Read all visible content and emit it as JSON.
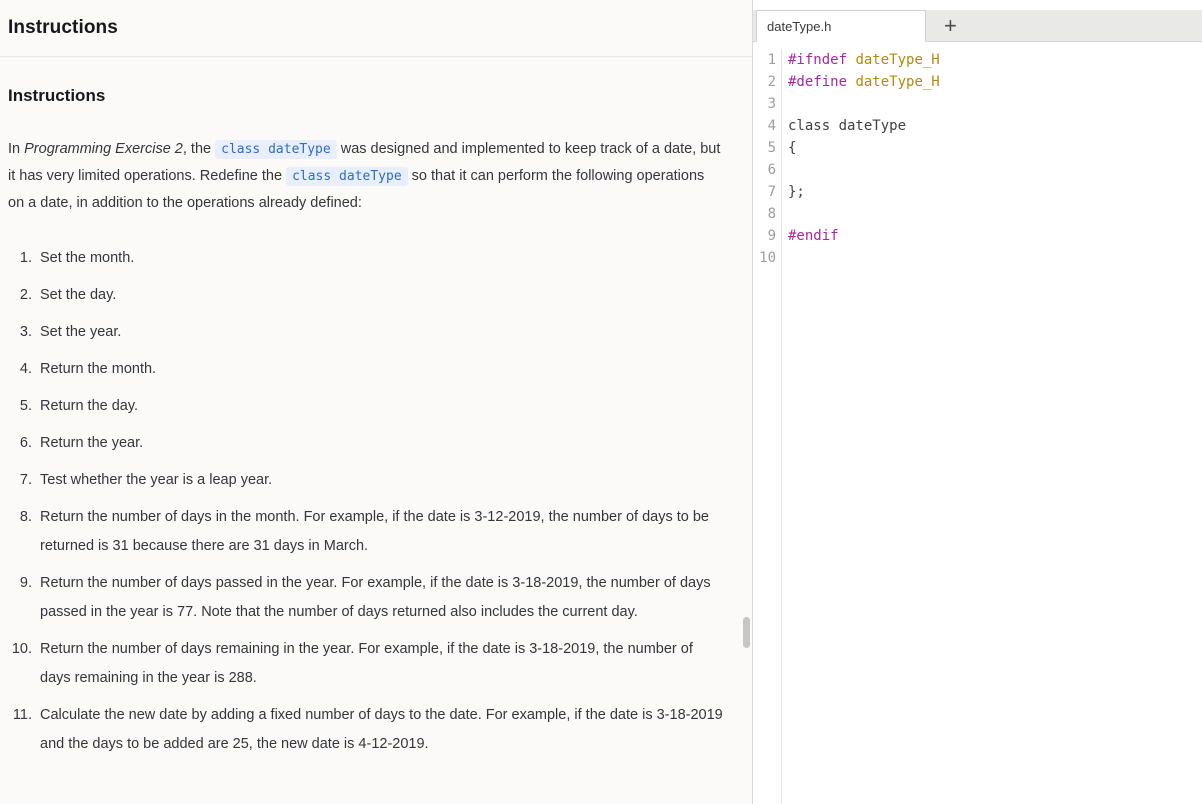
{
  "left_panel": {
    "header_title": "Instructions",
    "section_title": "Instructions",
    "intro_segments": [
      {
        "text": "In ",
        "style": "plain"
      },
      {
        "text": "Programming Exercise 2",
        "style": "italic"
      },
      {
        "text": ", the ",
        "style": "plain"
      },
      {
        "text": "class dateType",
        "style": "code"
      },
      {
        "text": " was designed and implemented to keep track of a date, but it has very limited operations. Redefine the ",
        "style": "plain"
      },
      {
        "text": "class dateType",
        "style": "code"
      },
      {
        "text": " so that it can perform the following operations on a date, in addition to the operations already defined:",
        "style": "plain"
      }
    ],
    "list_items": [
      "Set the month.",
      "Set the day.",
      "Set the year.",
      "Return the month.",
      "Return the day.",
      "Return the year.",
      "Test whether the year is a leap year.",
      "Return the number of days in the month. For example, if the date is 3-12-2019, the number of days to be returned is 31 because there are 31 days in March.",
      "Return the number of days passed in the year. For example, if the date is 3-18-2019, the number of days passed in the year is 77. Note that the number of days returned also includes the current day.",
      "Return the number of days remaining in the year. For example, if the date is 3-18-2019, the number of days remaining in the year is 288.",
      "Calculate the new date by adding a fixed number of days to the date. For example, if the date is 3-18-2019 and the days to be added are 25, the new date is 4-12-2019."
    ]
  },
  "editor": {
    "tab_label": "dateType.h",
    "new_tab_label": "+",
    "lines": [
      {
        "n": "1",
        "tokens": [
          [
            "#ifndef",
            "pp"
          ],
          [
            " ",
            "plain"
          ],
          [
            "dateType_H",
            "macro"
          ]
        ]
      },
      {
        "n": "2",
        "tokens": [
          [
            "#define",
            "pp"
          ],
          [
            " ",
            "plain"
          ],
          [
            "dateType_H",
            "macro"
          ]
        ]
      },
      {
        "n": "3",
        "tokens": []
      },
      {
        "n": "4",
        "tokens": [
          [
            "class dateType",
            "plain"
          ]
        ]
      },
      {
        "n": "5",
        "tokens": [
          [
            "{",
            "plain"
          ]
        ]
      },
      {
        "n": "6",
        "tokens": []
      },
      {
        "n": "7",
        "tokens": [
          [
            "};",
            "plain"
          ]
        ]
      },
      {
        "n": "8",
        "tokens": []
      },
      {
        "n": "9",
        "tokens": [
          [
            "#endif",
            "pp"
          ]
        ]
      },
      {
        "n": "10",
        "tokens": []
      }
    ]
  },
  "colors": {
    "preprocessor": "#a626a4",
    "macro": "#b5890b",
    "code_plain": "#3f4045",
    "inline_code_text": "#2f6cc0",
    "inline_code_bg": "#e8effb",
    "line_number": "#9c9da0",
    "panel_bg": "#fbfaf9",
    "tab_bar_bg": "#e9e9e8"
  }
}
